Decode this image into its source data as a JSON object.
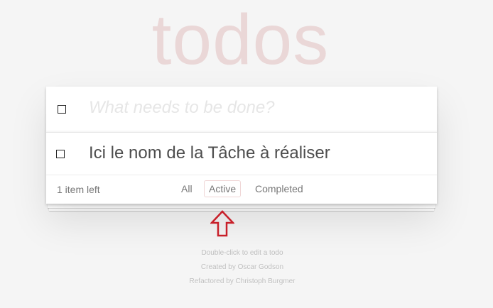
{
  "app": {
    "title": "todos",
    "new_todo_placeholder": "What needs to be done?"
  },
  "todos": [
    {
      "label": "Ici le nom de la Tâche à réaliser",
      "completed": false
    }
  ],
  "footer": {
    "count_text": "1 item left",
    "filters": [
      {
        "label": "All",
        "selected": false
      },
      {
        "label": "Active",
        "selected": true
      },
      {
        "label": "Completed",
        "selected": false
      }
    ]
  },
  "info": {
    "line1": "Double-click to edit a todo",
    "line2": "Created by Oscar Godson",
    "line3": "Refactored by Christoph Burgmer"
  },
  "annotation": {
    "icon": "up-arrow-icon",
    "color": "#c8202a"
  }
}
